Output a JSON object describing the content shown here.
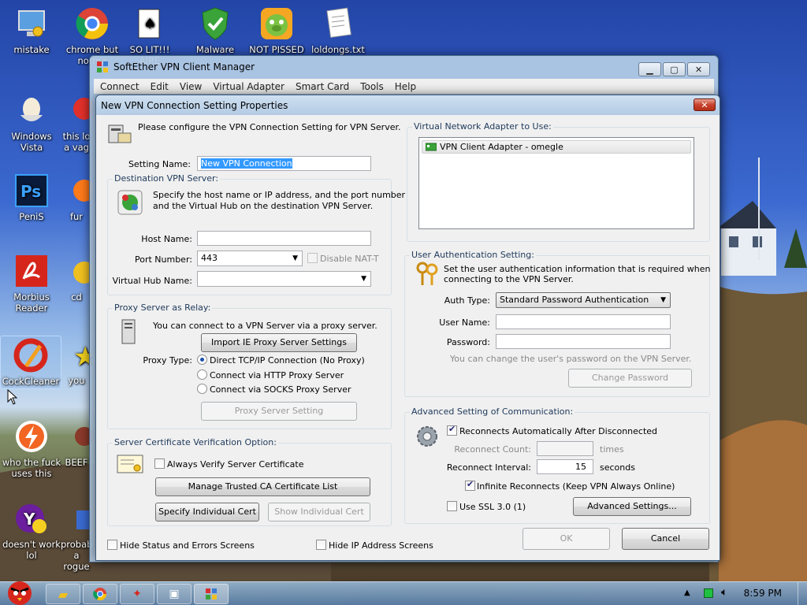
{
  "desktop": {
    "icons": [
      {
        "label": "mistake"
      },
      {
        "label": "chrome but norma"
      },
      {
        "label": "SO LIT!!! AIRE"
      },
      {
        "label": "Malware"
      },
      {
        "label": "NOT PISSED"
      },
      {
        "label": "loldongs.txt"
      },
      {
        "label": "Windows Vista"
      },
      {
        "label": "this lo a vag"
      },
      {
        "label": "PeniS"
      },
      {
        "label": "fur"
      },
      {
        "label": "Morbius Reader"
      },
      {
        "label": "cd"
      },
      {
        "label": "CockCleaner"
      },
      {
        "label": "you"
      },
      {
        "label": "who the fuck uses this"
      },
      {
        "label": "BEEF"
      },
      {
        "label": "doesn't work lol"
      },
      {
        "label": "probab a rogue"
      }
    ]
  },
  "main_window": {
    "title": "SoftEther VPN Client Manager",
    "menu": [
      "Connect",
      "Edit",
      "View",
      "Virtual Adapter",
      "Smart Card",
      "Tools",
      "Help"
    ]
  },
  "dialog": {
    "title": "New VPN Connection Setting Properties",
    "intro": "Please configure the VPN Connection Setting for VPN Server.",
    "setting_name_label": "Setting Name:",
    "setting_name_value": "New VPN Connection",
    "dest": {
      "title": "Destination VPN Server:",
      "desc1": "Specify the host name or IP address, and the port number",
      "desc2": "and the Virtual Hub on the destination VPN Server.",
      "host_label": "Host Name:",
      "host_value": "",
      "port_label": "Port Number:",
      "port_value": "443",
      "disable_natt": "Disable NAT-T",
      "hub_label": "Virtual Hub Name:",
      "hub_value": ""
    },
    "proxy": {
      "title": "Proxy Server as Relay:",
      "desc": "You can connect to a VPN Server via a proxy server.",
      "import_btn": "Import IE Proxy Server Settings",
      "type_label": "Proxy Type:",
      "options": [
        "Direct TCP/IP Connection (No Proxy)",
        "Connect via HTTP Proxy Server",
        "Connect via SOCKS Proxy Server"
      ],
      "setting_btn": "Proxy Server Setting"
    },
    "cert": {
      "title": "Server Certificate Verification Option:",
      "always_verify": "Always Verify Server Certificate",
      "manage_btn": "Manage Trusted CA Certificate List",
      "specify_btn": "Specify Individual Cert",
      "show_btn": "Show Individual Cert"
    },
    "adapter": {
      "title": "Virtual Network Adapter to Use:",
      "item": "VPN Client Adapter - omegle"
    },
    "auth": {
      "title": "User Authentication Setting:",
      "desc1": "Set the user authentication information that is required when",
      "desc2": "connecting to the VPN Server.",
      "type_label": "Auth Type:",
      "type_value": "Standard Password Authentication",
      "user_label": "User Name:",
      "user_value": "",
      "pass_label": "Password:",
      "pass_value": "",
      "hint": "You can change the user's password on the VPN Server.",
      "change_btn": "Change Password"
    },
    "advanced": {
      "title": "Advanced Setting of Communication:",
      "reconnect": "Reconnects Automatically After Disconnected",
      "count_label": "Reconnect Count:",
      "count_value": "",
      "times": "times",
      "interval_label": "Reconnect Interval:",
      "interval_value": "15",
      "seconds": "seconds",
      "infinite": "Infinite Reconnects (Keep VPN Always Online)",
      "ssl": "Use SSL 3.0 (1)",
      "adv_btn": "Advanced Settings..."
    },
    "hide_status": "Hide Status and Errors Screens",
    "hide_ip": "Hide IP Address Screens",
    "ok": "OK",
    "cancel": "Cancel"
  },
  "taskbar": {
    "clock": "8:59 PM"
  }
}
